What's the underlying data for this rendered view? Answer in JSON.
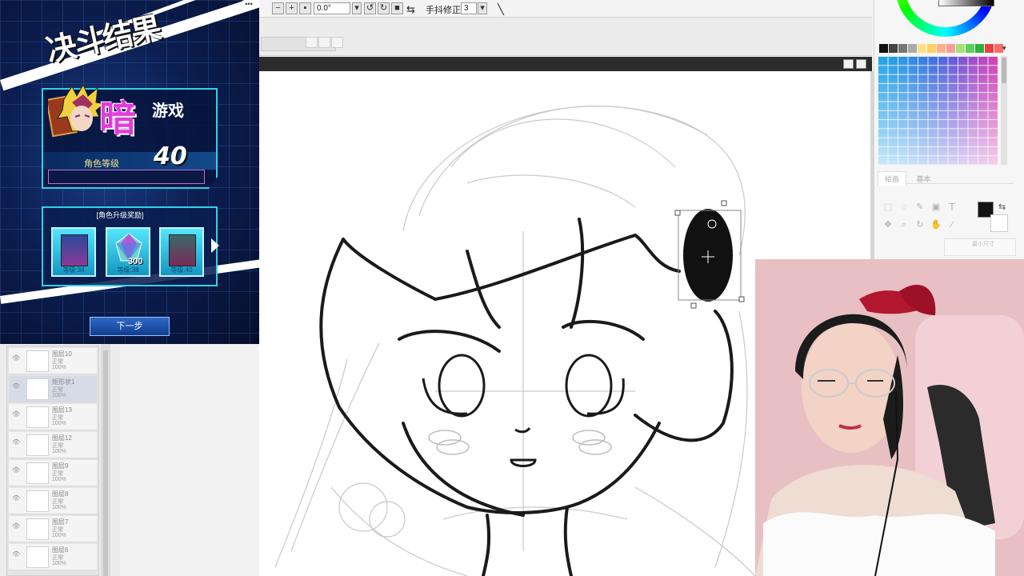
{
  "toolbar": {
    "angle_value": "0.0°",
    "stabilizer_label": "手抖修正",
    "stabilizer_value": "3"
  },
  "layers": [
    {
      "name": "图层10",
      "mode": "正常",
      "opacity": "100%"
    },
    {
      "name": "矩形状1",
      "mode": "正常",
      "opacity": "100%"
    },
    {
      "name": "图层13",
      "mode": "正常",
      "opacity": "100%"
    },
    {
      "name": "图层12",
      "mode": "正常",
      "opacity": "100%"
    },
    {
      "name": "图层9",
      "mode": "正常",
      "opacity": "100%"
    },
    {
      "name": "图层8",
      "mode": "正常",
      "opacity": "100%"
    },
    {
      "name": "图层7",
      "mode": "正常",
      "opacity": "100%"
    },
    {
      "name": "图层6",
      "mode": "正常",
      "opacity": "100%"
    }
  ],
  "color_panel": {
    "tabs": [
      "绘画",
      "基本"
    ],
    "primary_color": "#141414",
    "secondary_color": "#ffffff",
    "top_swatches": [
      "#111111",
      "#444444",
      "#777777",
      "#aaaaaa",
      "#ffe08a",
      "#ffd066",
      "#ffb08a",
      "#ff9a9a",
      "#a6e07a",
      "#5ccf5c",
      "#2fae3c",
      "#e84040",
      "#ff6b6b"
    ],
    "size_label": "最小尺寸"
  },
  "game": {
    "title": "决斗结果",
    "character_prefix": "暗",
    "character_suffix": "游戏",
    "level_label": "角色等级",
    "level": "40",
    "exp_fraction": 0,
    "reward_title": "[角色升级奖励]",
    "rewards": [
      {
        "label": "等级:38",
        "kind": "card"
      },
      {
        "label": "等级:38",
        "kind": "gem",
        "count": "300"
      },
      {
        "label": "等级:40",
        "kind": "card"
      }
    ],
    "next_button": "下一步"
  },
  "colors": {
    "accent_cyan": "#2fd2e8",
    "game_bg": "#0c1f52",
    "char_pink": "#e23bd8"
  }
}
